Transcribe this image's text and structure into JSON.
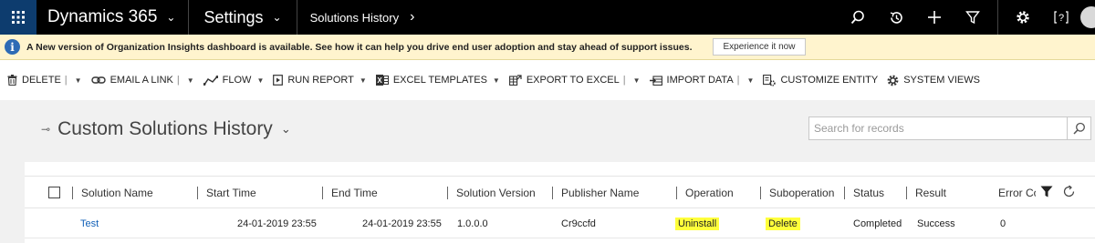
{
  "topbar": {
    "app_name": "Dynamics 365",
    "area": "Settings",
    "subarea": "Solutions History",
    "chevron": "⌄",
    "arrow": "›",
    "icons": [
      "search-icon",
      "history-icon",
      "plus-icon",
      "filter-icon",
      "gear-icon",
      "help-icon",
      "avatar"
    ]
  },
  "notification": {
    "text": "A New version of Organization Insights dashboard is available. See how it can help you drive end user adoption and stay ahead of support issues.",
    "button": "Experience it now",
    "info_glyph": "i"
  },
  "commands": [
    {
      "label": "DELETE",
      "icon": "trash-icon"
    },
    {
      "label": "EMAIL A LINK",
      "icon": "link-icon"
    },
    {
      "label": "FLOW",
      "icon": "flow-icon"
    },
    {
      "label": "RUN REPORT",
      "icon": "report-icon"
    },
    {
      "label": "EXCEL TEMPLATES",
      "icon": "excel-icon"
    },
    {
      "label": "EXPORT TO EXCEL",
      "icon": "export-excel-icon"
    },
    {
      "label": "IMPORT DATA",
      "icon": "import-icon"
    },
    {
      "label": "CUSTOMIZE ENTITY",
      "icon": "customize-icon"
    },
    {
      "label": "SYSTEM VIEWS",
      "icon": "gear-icon"
    }
  ],
  "view": {
    "title": "Custom Solutions History",
    "search_placeholder": "Search for records"
  },
  "grid": {
    "columns": [
      "Solution Name",
      "Start Time",
      "End Time",
      "Solution Version",
      "Publisher Name",
      "Operation",
      "Suboperation",
      "Status",
      "Result",
      "Error Co"
    ],
    "rows": [
      {
        "solution_name": "Test",
        "start_time": "24-01-2019 23:55",
        "end_time": "24-01-2019 23:55",
        "solution_version": "1.0.0.0",
        "publisher_name": "Cr9ccfd",
        "operation": "Uninstall",
        "suboperation": "Delete",
        "status": "Completed",
        "result": "Success",
        "error_code": "0"
      }
    ],
    "highlight_color": "#ffff3b"
  },
  "colors": {
    "topbar": "#000000",
    "waffle": "#0d3c6e",
    "notification_bg": "#fff4ce",
    "link": "#1160b7"
  }
}
